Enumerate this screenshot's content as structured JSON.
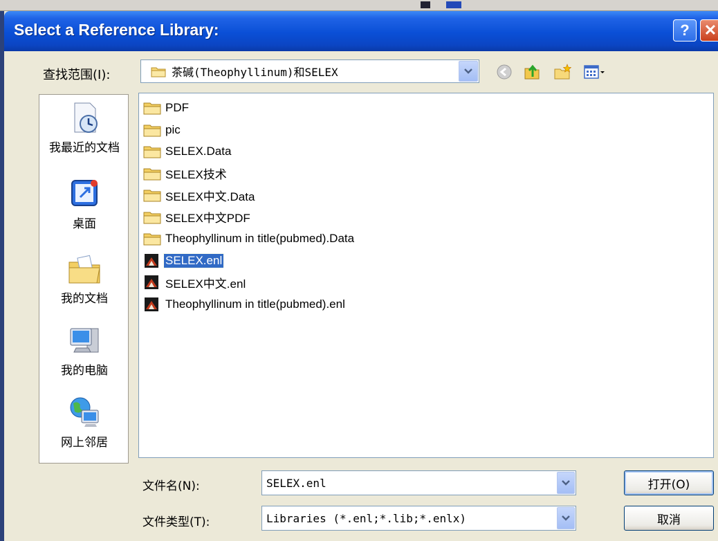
{
  "dialog": {
    "title": "Select a Reference Library:",
    "help_button": "?",
    "close_button": "✕"
  },
  "look_in": {
    "label": "查找范围(I):",
    "value": "茶碱(Theophyllinum)和SELEX"
  },
  "toolbar_icons": [
    "back-icon",
    "up-folder-icon",
    "new-folder-icon",
    "view-menu-icon"
  ],
  "places": [
    {
      "label": "我最近的文档",
      "icon": "recent-documents-icon"
    },
    {
      "label": "桌面",
      "icon": "desktop-icon"
    },
    {
      "label": "我的文档",
      "icon": "my-documents-icon"
    },
    {
      "label": "我的电脑",
      "icon": "my-computer-icon"
    },
    {
      "label": "网上邻居",
      "icon": "network-places-icon"
    }
  ],
  "files": [
    {
      "name": "PDF",
      "type": "folder"
    },
    {
      "name": "pic",
      "type": "folder"
    },
    {
      "name": "SELEX.Data",
      "type": "folder"
    },
    {
      "name": "SELEX技术",
      "type": "folder"
    },
    {
      "name": "SELEX中文.Data",
      "type": "folder"
    },
    {
      "name": "SELEX中文PDF",
      "type": "folder"
    },
    {
      "name": "Theophyllinum in title(pubmed).Data",
      "type": "folder"
    },
    {
      "name": "SELEX.enl",
      "type": "library",
      "selected": true
    },
    {
      "name": "SELEX中文.enl",
      "type": "library"
    },
    {
      "name": "Theophyllinum in title(pubmed).enl",
      "type": "library"
    }
  ],
  "filename": {
    "label": "文件名(N):",
    "value": "SELEX.enl"
  },
  "filetype": {
    "label": "文件类型(T):",
    "value": "Libraries (*.enl;*.lib;*.enlx)"
  },
  "buttons": {
    "open": "打开(O)",
    "cancel": "取消"
  }
}
